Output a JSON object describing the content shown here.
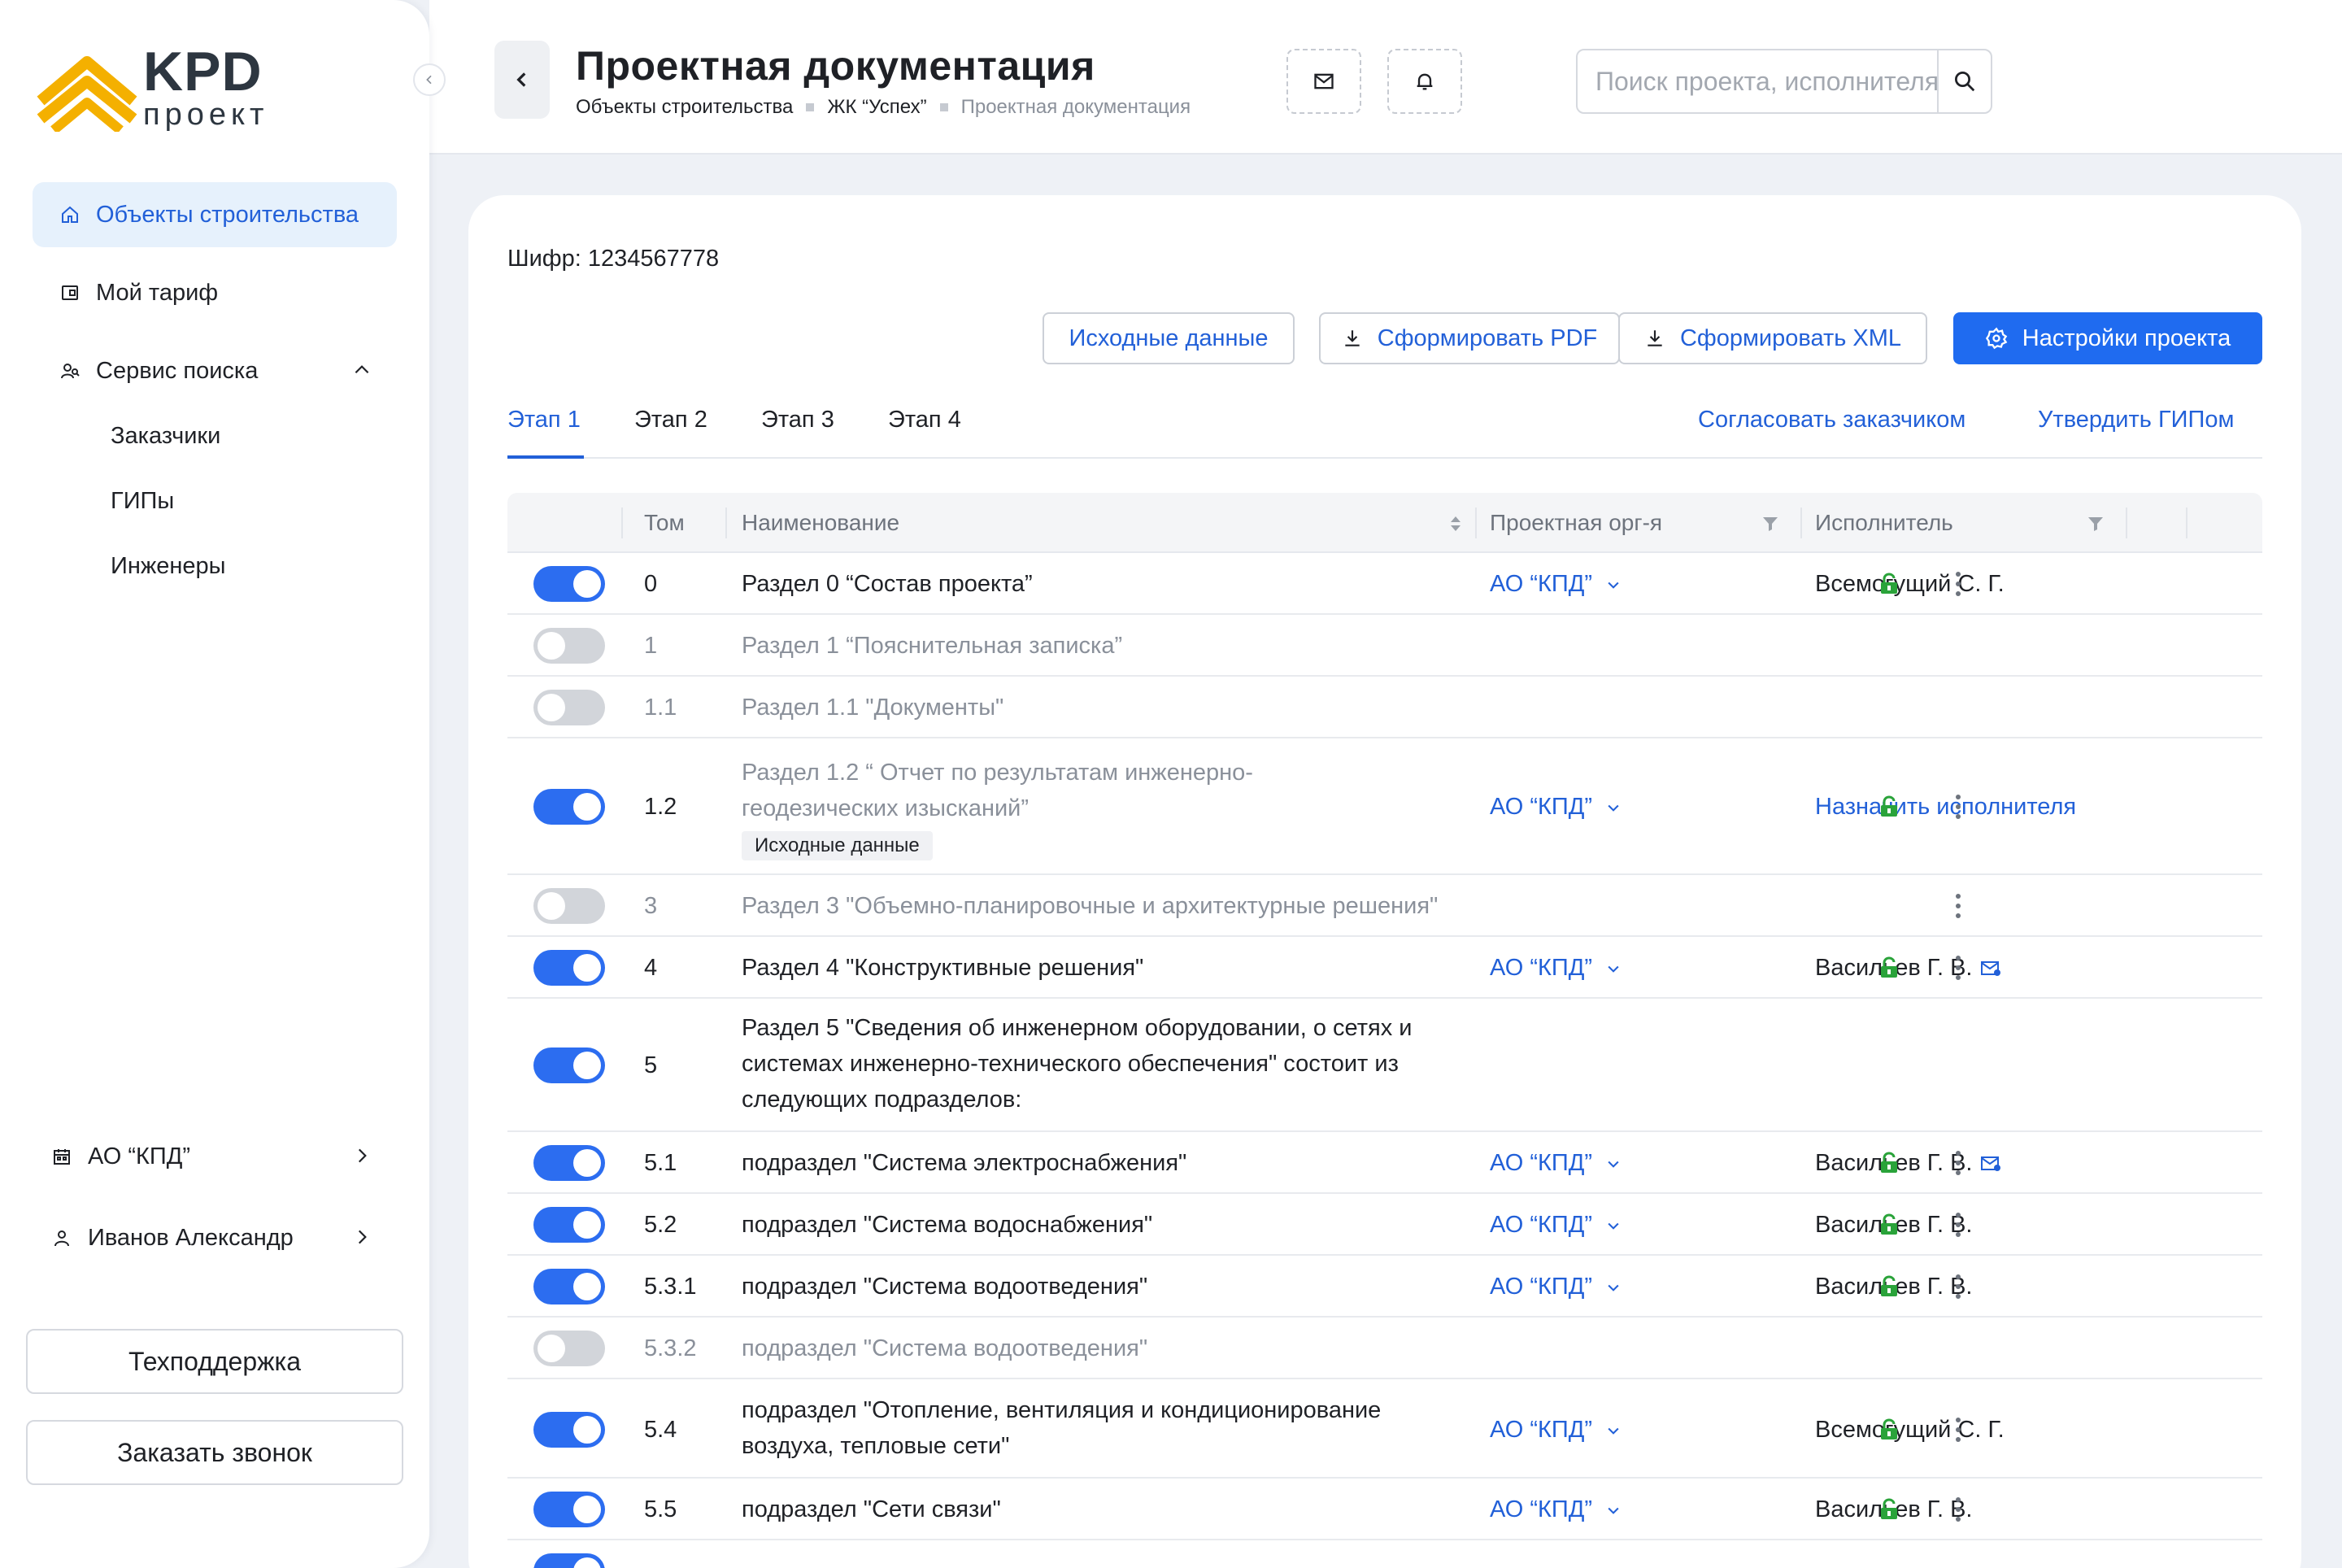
{
  "sidebar": {
    "logo": {
      "brand": "KPD",
      "sub": "проект"
    },
    "nav": [
      {
        "label": "Объекты строительства",
        "icon": "home-icon",
        "active": true
      },
      {
        "label": "Мой тариф",
        "icon": "wallet-icon"
      },
      {
        "label": "Сервис поиска",
        "icon": "people-search-icon",
        "expanded": true
      }
    ],
    "search_sub": [
      "Заказчики",
      "ГИПы",
      "Инженеры"
    ],
    "org": {
      "label": "АО “КПД”",
      "icon": "calendar-icon"
    },
    "user": {
      "label": "Иванов Александр",
      "icon": "user-icon"
    },
    "support_label": "Техподдержка",
    "callback_label": "Заказать звонок"
  },
  "header": {
    "title": "Проектная документация",
    "breadcrumb": [
      "Объекты строительства",
      "ЖК “Успех”",
      "Проектная документация"
    ],
    "search_placeholder": "Поиск проекта, исполнителя"
  },
  "main": {
    "cipher": "Шифр: 1234567778",
    "buttons": {
      "source": "Исходные данные",
      "pdf": "Сформировать PDF",
      "xml": "Сформировать XML",
      "settings": "Настройки проекта"
    },
    "tabs": [
      "Этап 1",
      "Этап 2",
      "Этап 3",
      "Этап 4"
    ],
    "active_tab": 0,
    "tab_actions": {
      "approve_customer": "Согласовать заказчиком",
      "approve_gip": "Утвердить ГИПом"
    },
    "columns": {
      "tom": "Том",
      "name": "Наименование",
      "org": "Проектная орг-я",
      "executor": "Исполнитель"
    },
    "rows": [
      {
        "on": true,
        "tom": "0",
        "name": "Раздел 0 “Состав проекта”",
        "org": "АО “КПД”",
        "executor": "Всемогущий С. Г.",
        "lock": true,
        "menu": true
      },
      {
        "on": false,
        "tom": "1",
        "name": "Раздел 1 “Пояснительная записка”"
      },
      {
        "on": false,
        "tom": "1.1",
        "name": "Раздел 1.1 \"Документы\""
      },
      {
        "on": true,
        "tom": "1.2",
        "name_line1": "Раздел 1.2 “ Отчет по результатам инженерно-",
        "name_line2": "геодезических изысканий”",
        "tag": "Исходные данные",
        "org": "АО “КПД”",
        "executor": "Назначить исполнителя",
        "lock": true,
        "menu": true
      },
      {
        "on": false,
        "tom": "3",
        "name": "Раздел 3 \"Объемно-планировочные и архитектурные решения\"",
        "menu": true
      },
      {
        "on": true,
        "tom": "4",
        "name": "Раздел 4 \"Конструктивные решения\"",
        "org": "АО “КПД”",
        "executor": "Васильев Г. В.",
        "mail": true,
        "lock": true,
        "menu": true
      },
      {
        "on": true,
        "tom": "5",
        "name_line1": "Раздел 5 \"Сведения об инженерном оборудовании, о сетях и",
        "name_line2": "системах инженерно-технического обеспечения\" состоит из",
        "name_line3": "следующих подразделов:"
      },
      {
        "on": true,
        "tom": "5.1",
        "name": "подраздел \"Система электроснабжения\"",
        "org": "АО “КПД”",
        "executor": "Васильев Г. В.",
        "mail": true,
        "lock": true,
        "menu": true
      },
      {
        "on": true,
        "tom": "5.2",
        "name": "подраздел \"Система водоснабжения\"",
        "org": "АО “КПД”",
        "executor": "Васильев Г. В.",
        "lock": true,
        "menu": true
      },
      {
        "on": true,
        "tom": "5.3.1",
        "name": "подраздел \"Система водоотведения\"",
        "org": "АО “КПД”",
        "executor": "Васильев Г. В.",
        "lock": true,
        "menu": true
      },
      {
        "on": false,
        "tom": "5.3.2",
        "name": "подраздел \"Система водоотведения\""
      },
      {
        "on": true,
        "tom": "5.4",
        "name_line1": "подраздел \"Отопление, вентиляция и кондиционирование",
        "name_line2": "воздуха, тепловые сети\"",
        "org": "АО “КПД”",
        "executor": "Всемогущий С. Г.",
        "lock": true,
        "menu": true
      },
      {
        "on": true,
        "tom": "5.5",
        "name": "подраздел \"Сети связи\"",
        "org": "АО “КПД”",
        "executor": "Васильев Г. В.",
        "lock": true,
        "menu": true
      }
    ]
  },
  "colors": {
    "accent": "#1f6bf0",
    "link": "#2260d8",
    "lock": "#2aa33a",
    "logo_orange": "#f4b000"
  }
}
